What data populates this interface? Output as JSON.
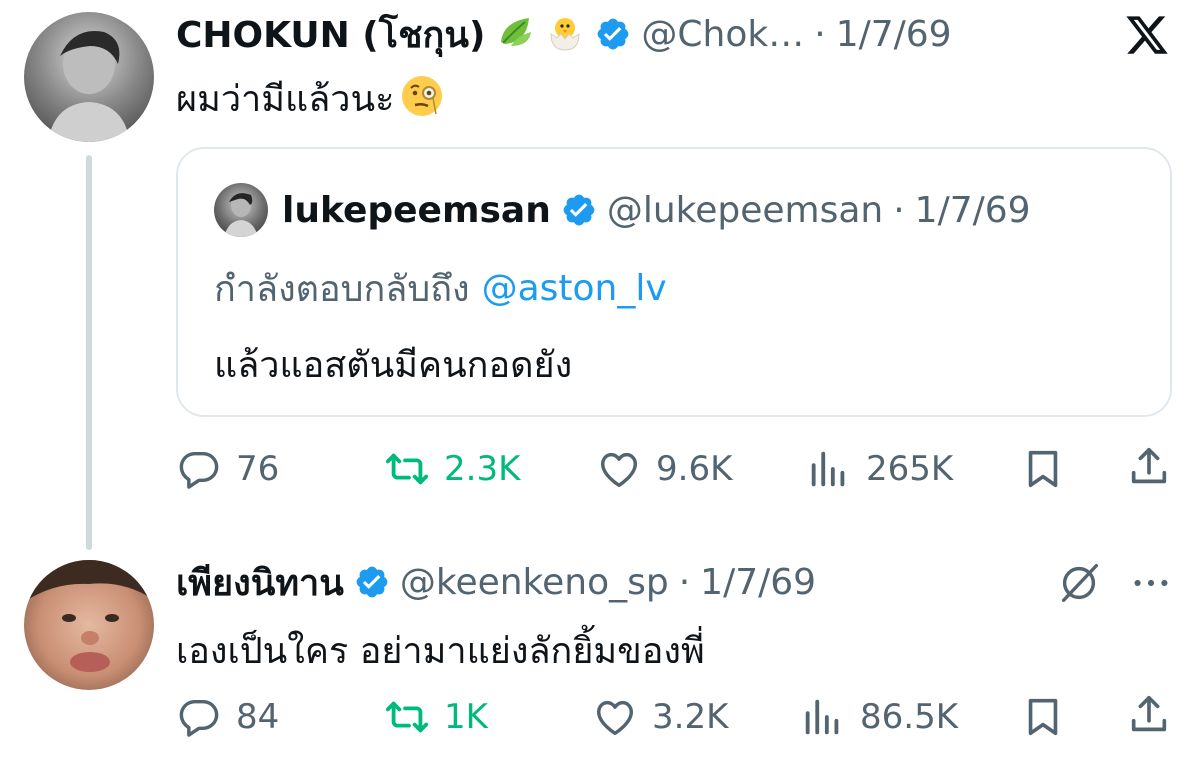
{
  "tweet1": {
    "name": "CHOKUN (โชกุน)",
    "emoji_names": [
      "leaf-emoji",
      "hatching-chick-emoji"
    ],
    "handle": "@Chok…",
    "sep": "·",
    "date": "1/7/69",
    "text": "ผมว่ามีแล้วนะ",
    "text_emoji": "face-with-monocle-emoji",
    "quote": {
      "name": "lukepeemsan",
      "handle": "@lukepeemsan",
      "sep": "·",
      "date": "1/7/69",
      "replying_prefix": "กำลังตอบกลับถึง",
      "replying_to": "@aston_lv",
      "text": "แล้วแอสตันมีคนกอดยัง"
    },
    "stats": {
      "replies": "76",
      "retweets": "2.3K",
      "likes": "9.6K",
      "views": "265K"
    }
  },
  "tweet2": {
    "name": "เพียงนิทาน",
    "handle": "@keenkeno_sp",
    "sep": "·",
    "date": "1/7/69",
    "text": "เองเป็นใคร อย่ามาแย่งลักยิ้มของพี่",
    "stats": {
      "replies": "84",
      "retweets": "1K",
      "likes": "3.2K",
      "views": "86.5K"
    }
  },
  "colors": {
    "verified": "#1d9bf0",
    "retweet": "#00ba7c",
    "secondary": "#536471",
    "link": "#1d9bf0"
  },
  "icons": [
    "x-logo-icon",
    "reply-icon",
    "retweet-icon",
    "like-icon",
    "views-icon",
    "bookmark-icon",
    "share-icon",
    "grok-icon",
    "more-icon"
  ]
}
